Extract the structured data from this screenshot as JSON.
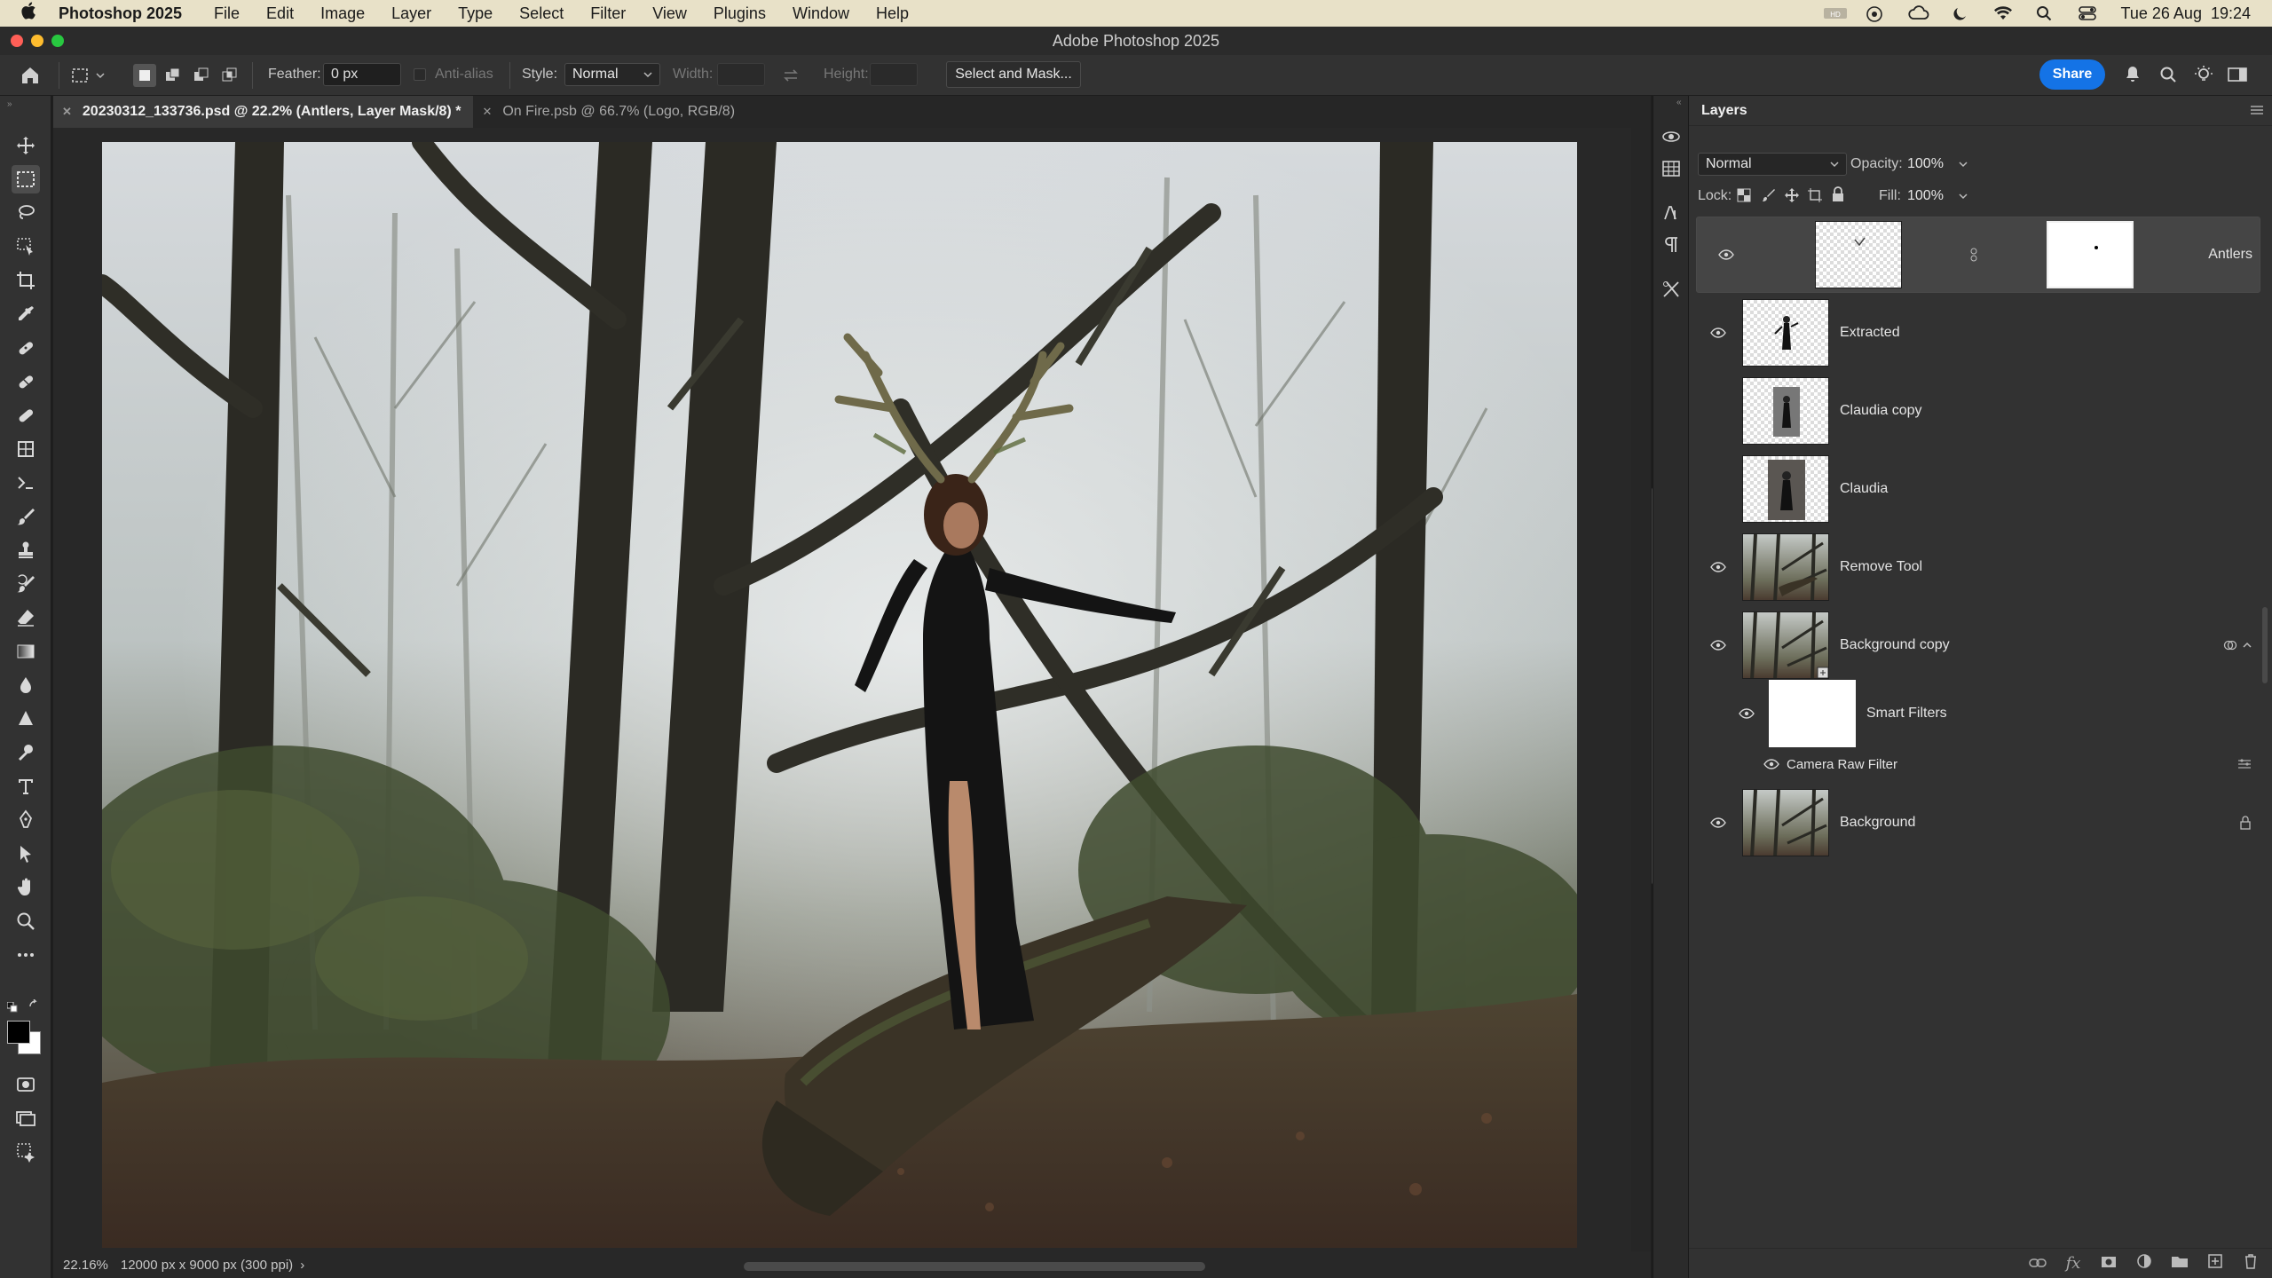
{
  "menubar": {
    "apple": "",
    "app_name": "Photoshop 2025",
    "items": [
      "File",
      "Edit",
      "Image",
      "Layer",
      "Type",
      "Select",
      "Filter",
      "View",
      "Plugins",
      "Window",
      "Help"
    ],
    "clock": "Tue 26 Aug  19:24"
  },
  "window": {
    "title": "Adobe Photoshop 2025"
  },
  "options": {
    "feather_label": "Feather:",
    "feather_value": "0 px",
    "antialias_label": "Anti-alias",
    "style_label": "Style:",
    "style_value": "Normal",
    "width_label": "Width:",
    "height_label": "Height:",
    "select_mask_label": "Select and Mask...",
    "share_label": "Share"
  },
  "tabs": [
    {
      "label": "20230312_133736.psd @ 22.2% (Antlers, Layer Mask/8) *",
      "active": true
    },
    {
      "label": "On Fire.psb @ 66.7% (Logo, RGB/8)",
      "active": false
    }
  ],
  "status": {
    "zoom": "22.16%",
    "doc_info": "12000 px x 9000 px (300 ppi)",
    "arrow": "›"
  },
  "layers_panel": {
    "title": "Layers",
    "blend_mode": "Normal",
    "opacity_label": "Opacity:",
    "opacity_value": "100%",
    "lock_label": "Lock:",
    "fill_label": "Fill:",
    "fill_value": "100%",
    "layers": [
      {
        "name": "Antlers",
        "visible": true,
        "selected": true,
        "has_mask": true
      },
      {
        "name": "Extracted",
        "visible": true
      },
      {
        "name": "Claudia copy",
        "visible": false
      },
      {
        "name": "Claudia",
        "visible": false
      },
      {
        "name": "Remove Tool",
        "visible": true
      },
      {
        "name": "Background copy",
        "visible": true,
        "smart_object": true
      },
      {
        "name": "Background",
        "visible": true,
        "locked": true
      }
    ],
    "smart_filters_label": "Smart Filters",
    "camera_raw_label": "Camera Raw Filter"
  },
  "colors": {
    "accent": "#1473e6",
    "menubar": "#e8e1c8",
    "panel": "#323232",
    "canvas_bg": "#282828"
  }
}
